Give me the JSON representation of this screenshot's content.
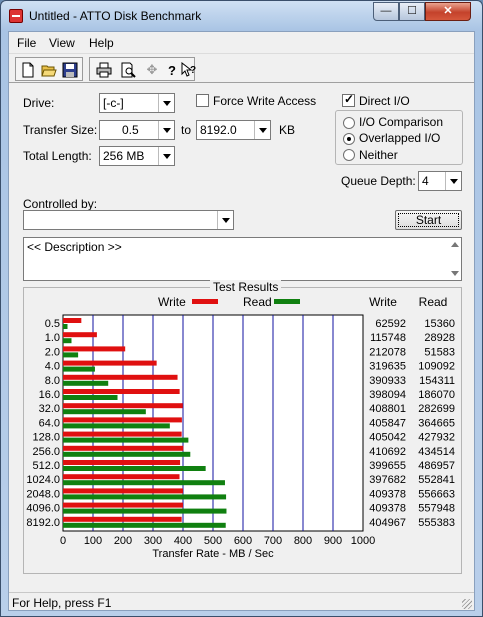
{
  "window": {
    "title": "Untitled - ATTO Disk Benchmark",
    "minimize": "—",
    "maximize": "☐",
    "close": "✕"
  },
  "menu": [
    "File",
    "View",
    "Help"
  ],
  "toolbar": [
    "new-file-icon",
    "open-folder-icon",
    "save-disk-icon",
    "print-icon",
    "print-preview-icon",
    "move-icon",
    "help-icon",
    "context-help-icon"
  ],
  "settings": {
    "drive_label": "Drive:",
    "drive_value": "[-c-]",
    "transfer_size_label": "Transfer Size:",
    "transfer_from": "0.5",
    "to_label": "to",
    "transfer_to": "8192.0",
    "unit": "KB",
    "total_length_label": "Total Length:",
    "total_length_value": "256 MB",
    "force_write_access": "Force Write Access",
    "direct_io": "Direct I/O",
    "io_comparison": "I/O Comparison",
    "overlapped_io": "Overlapped I/O",
    "neither": "Neither",
    "queue_depth_label": "Queue Depth:",
    "queue_depth_value": "4",
    "controlled_by_label": "Controlled by:",
    "controlled_by_value": "",
    "start_button": "Start",
    "description": "<< Description >>"
  },
  "chart_data": {
    "type": "bar",
    "title": "Test Results",
    "xlabel": "Transfer Rate - MB / Sec",
    "xlim": [
      0,
      1000
    ],
    "xticks": [
      "0",
      "100",
      "200",
      "300",
      "400",
      "500",
      "600",
      "700",
      "800",
      "900",
      "1000"
    ],
    "categories": [
      "0.5",
      "1.0",
      "2.0",
      "4.0",
      "8.0",
      "16.0",
      "32.0",
      "64.0",
      "128.0",
      "256.0",
      "512.0",
      "1024.0",
      "2048.0",
      "4096.0",
      "8192.0"
    ],
    "series": [
      {
        "name": "Write",
        "color": "#e01010",
        "values": [
          61.1,
          113.0,
          207.3,
          312.1,
          381.8,
          388.8,
          399.2,
          396.3,
          395.5,
          401.0,
          390.3,
          388.4,
          399.8,
          399.8,
          395.5
        ]
      },
      {
        "name": "Read",
        "color": "#108010",
        "values": [
          15.0,
          28.3,
          50.4,
          106.5,
          150.7,
          181.7,
          276.1,
          356.1,
          417.9,
          424.3,
          475.5,
          539.9,
          543.6,
          544.9,
          542.4
        ]
      }
    ],
    "table_headers": [
      "Write",
      "Read"
    ],
    "table_rows": [
      [
        "62592",
        "15360"
      ],
      [
        "115748",
        "28928"
      ],
      [
        "212078",
        "51583"
      ],
      [
        "319635",
        "109092"
      ],
      [
        "390933",
        "154311"
      ],
      [
        "398094",
        "186070"
      ],
      [
        "408801",
        "282699"
      ],
      [
        "405847",
        "364665"
      ],
      [
        "405042",
        "427932"
      ],
      [
        "410692",
        "434514"
      ],
      [
        "399655",
        "486957"
      ],
      [
        "397682",
        "552841"
      ],
      [
        "409378",
        "556663"
      ],
      [
        "409378",
        "557948"
      ],
      [
        "404967",
        "555383"
      ]
    ]
  },
  "status": "For Help, press F1"
}
